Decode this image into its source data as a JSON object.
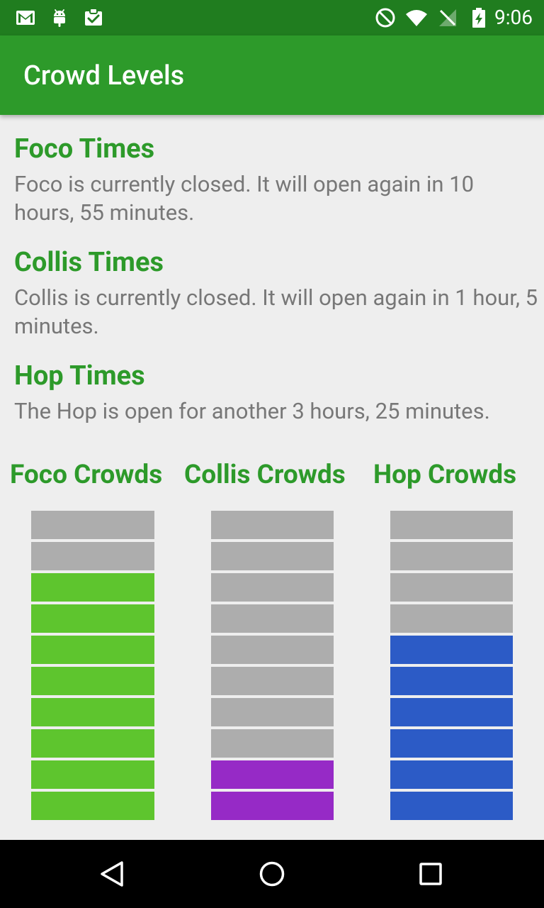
{
  "status_bar": {
    "time": "9:06",
    "left_icons": [
      "gmail-icon",
      "android-icon",
      "clipboard-check-icon"
    ],
    "right_icons": [
      "do-not-disturb-icon",
      "wifi-icon",
      "no-signal-icon",
      "battery-charging-icon"
    ]
  },
  "app_bar": {
    "title": "Crowd Levels"
  },
  "sections": [
    {
      "heading": "Foco Times",
      "body": "Foco is currently closed.  It will open again in 10 hours, 55 minutes."
    },
    {
      "heading": "Collis Times",
      "body": "Collis is currently closed.  It will open again in 1 hour, 5 minutes."
    },
    {
      "heading": "Hop Times",
      "body": "The Hop is open for another 3 hours, 25 minutes."
    }
  ],
  "crowds": [
    {
      "heading": "Foco Crowds",
      "total_segments": 10,
      "filled_segments": 8,
      "fill_color": "#5ec52e",
      "empty_color": "#adadad"
    },
    {
      "heading": "Collis Crowds",
      "total_segments": 10,
      "filled_segments": 2,
      "fill_color": "#962ac6",
      "empty_color": "#adadad"
    },
    {
      "heading": "Hop Crowds",
      "total_segments": 10,
      "filled_segments": 6,
      "fill_color": "#2c5bc6",
      "empty_color": "#adadad"
    }
  ],
  "nav_bar": {
    "icons": [
      "back-icon",
      "home-icon",
      "recents-icon"
    ]
  },
  "colors": {
    "status_bar": "#207d1f",
    "app_bar": "#2d9a2a",
    "accent_text": "#2d9a2a",
    "body_text": "#777777",
    "background": "#eeeeee"
  }
}
